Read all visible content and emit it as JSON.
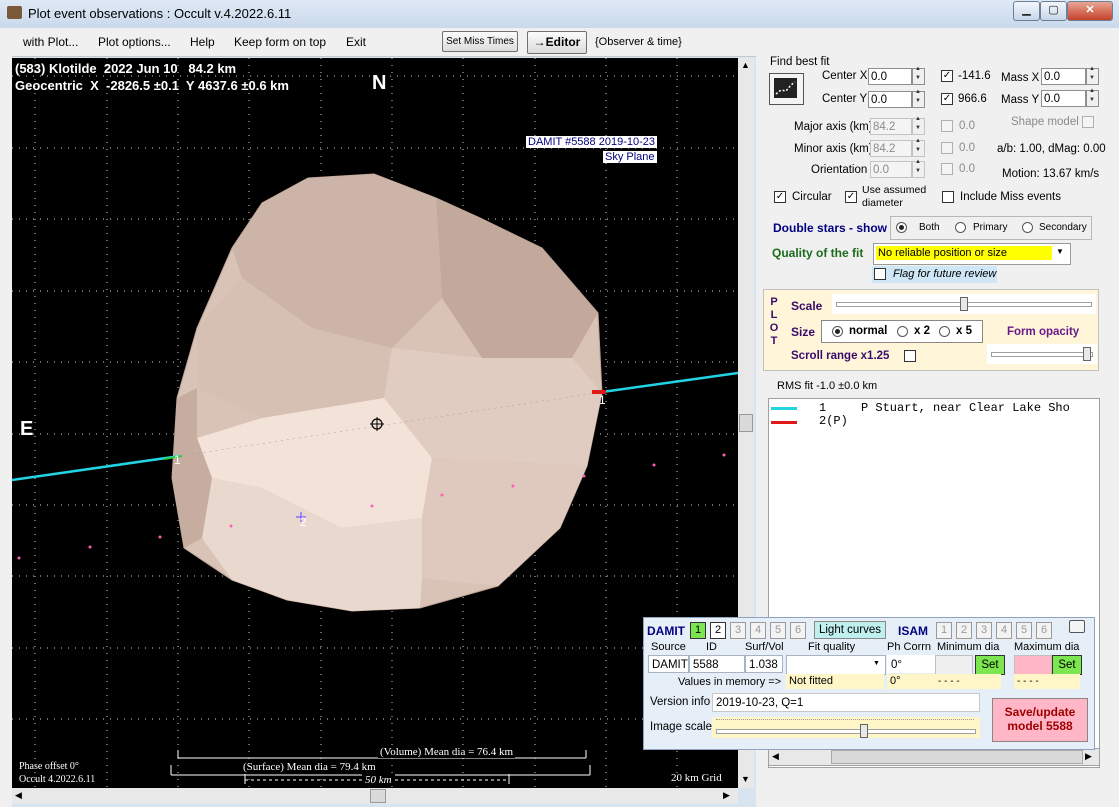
{
  "window": {
    "title": "Plot event observations : Occult v.4.2022.6.11",
    "min": "▁",
    "max": "▢",
    "close": "✕"
  },
  "menu": {
    "items": [
      "with Plot...",
      "Plot options...",
      "Help",
      "Keep form on top",
      "Exit"
    ],
    "set_miss_times": "Set Miss Times",
    "editor": "→Editor",
    "observer_time": "{Observer & time}"
  },
  "plot": {
    "line1": "(583) Klotilde  2022 Jun 10   84.2 km",
    "line2": "Geocentric  X  -2826.5 ±0.1  Y 4637.6 ±0.6 km",
    "north": "N",
    "east": "E",
    "damit_label1": "DAMIT #5588 2019-10-23",
    "damit_label2": "Sky Plane",
    "chord1_label": "1",
    "chord1b_label": "1",
    "star2_label": "2",
    "volume_dia": "(Volume) Mean dia = 76.4 km",
    "surface_dia": "(Surface) Mean dia = 79.4 km",
    "scale_50": "50 km",
    "phase_offset": "Phase offset 0°",
    "occult_ver": "Occult 4.2022.6.11",
    "grid": "20 km Grid",
    "colors": {
      "chord1": "#22d3e6",
      "chord2": "#e01818",
      "body": "#e8d5c8"
    }
  },
  "fit": {
    "find_best_fit": "Find best fit",
    "center_x_label": "Center X",
    "center_x": "0.0",
    "center_y_label": "Center Y",
    "center_y": "0.0",
    "x_val": "-141.6",
    "y_val": "966.6",
    "mass_x_label": "Mass X",
    "mass_x": "0.0",
    "mass_y_label": "Mass Y",
    "mass_y": "0.0",
    "major_label": "Major axis (km)",
    "major": "84.2",
    "major_chk": "0.0",
    "minor_label": "Minor axis (km)",
    "minor": "84.2",
    "minor_chk": "0.0",
    "orient_label": "Orientation",
    "orient": "0.0",
    "orient_chk": "0.0",
    "shape_model": "Shape model",
    "ab_ratio": "a/b: 1.00, dMag: 0.00",
    "motion": "Motion: 13.67 km/s",
    "circular": "Circular",
    "use_assumed": "Use assumed",
    "diameter": "diameter",
    "include_miss": "Include Miss events",
    "double_stars": "Double stars - show",
    "both": "Both",
    "primary": "Primary",
    "secondary": "Secondary",
    "quality_label": "Quality of the fit",
    "quality_value": "No reliable position or size",
    "flag_review": "Flag for future review"
  },
  "plotbox": {
    "plot_letters": [
      "P",
      "L",
      "O",
      "T"
    ],
    "scale": "Scale",
    "size": "Size",
    "normal": "normal",
    "x2": "x 2",
    "x5": "x 5",
    "form_opacity": "Form opacity",
    "scroll_range": "Scroll range x1.25",
    "scale_level": 0.5,
    "opacity_level": 0.95
  },
  "rms": "RMS fit -1.0 ±0.0 km",
  "observers": [
    {
      "num": "1",
      "text": "P Stuart, near Clear Lake Sho",
      "color": "#22d3e6"
    },
    {
      "num": "2(P)",
      "text": "",
      "color": "#e01818"
    }
  ],
  "damit": {
    "damit_label": "DAMIT",
    "damit_nums": [
      "1",
      "2",
      "3",
      "4",
      "5",
      "6"
    ],
    "light_curves": "Light curves",
    "isam_label": "ISAM",
    "isam_nums": [
      "1",
      "2",
      "3",
      "4",
      "5",
      "6"
    ],
    "source_hdr": "Source",
    "id_hdr": "ID",
    "surfvol_hdr": "Surf/Vol",
    "fitq_hdr": "Fit quality",
    "phcorrn_hdr": "Ph Corrn",
    "mindia_hdr": "Minimum dia",
    "maxdia_hdr": "Maximum dia",
    "source": "DAMIT",
    "id": "5588",
    "surfvol": "1.038",
    "phcorrn": "0°",
    "phcorrn2": "0°",
    "values_in_memory": "Values in memory =>",
    "not_fitted": "Not fitted",
    "dash1": "- - - -",
    "dash2": "- - - -",
    "set1": "Set",
    "set2": "Set",
    "version_info_label": "Version info",
    "version_info": "2019-10-23, Q=1",
    "image_scale": "Image scale",
    "save_update": "Save/update",
    "model": "model 5588"
  }
}
